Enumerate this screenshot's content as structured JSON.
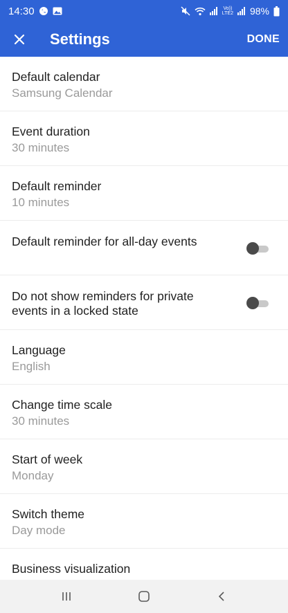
{
  "status_bar": {
    "time": "14:30",
    "battery": "98%",
    "network_label_top": "Vo))",
    "network_label_bottom": "LTE2",
    "icons": [
      "whatsapp-icon",
      "gallery-icon",
      "mute-icon",
      "wifi-icon",
      "signal-icon",
      "battery-icon"
    ]
  },
  "app_bar": {
    "title": "Settings",
    "done_label": "DONE",
    "close_icon": "close-icon",
    "background": "#2f63d6"
  },
  "settings": {
    "default_calendar": {
      "title": "Default calendar",
      "value": "Samsung Calendar"
    },
    "event_duration": {
      "title": "Event duration",
      "value": "30 minutes"
    },
    "default_reminder": {
      "title": "Default reminder",
      "value": "10 minutes"
    },
    "all_day_reminder": {
      "title": "Default reminder for all-day events",
      "enabled": false
    },
    "private_reminders": {
      "title": "Do not show reminders for private events in a locked state",
      "enabled": false
    },
    "language": {
      "title": "Language",
      "value": "English"
    },
    "time_scale": {
      "title": "Change time scale",
      "value": "30 minutes"
    },
    "start_of_week": {
      "title": "Start of week",
      "value": "Monday"
    },
    "switch_theme": {
      "title": "Switch theme",
      "value": "Day mode"
    },
    "business_visualization": {
      "title": "Business visualization"
    }
  },
  "nav_bar": {
    "icons": [
      "recent-apps-icon",
      "home-icon",
      "back-icon"
    ]
  }
}
